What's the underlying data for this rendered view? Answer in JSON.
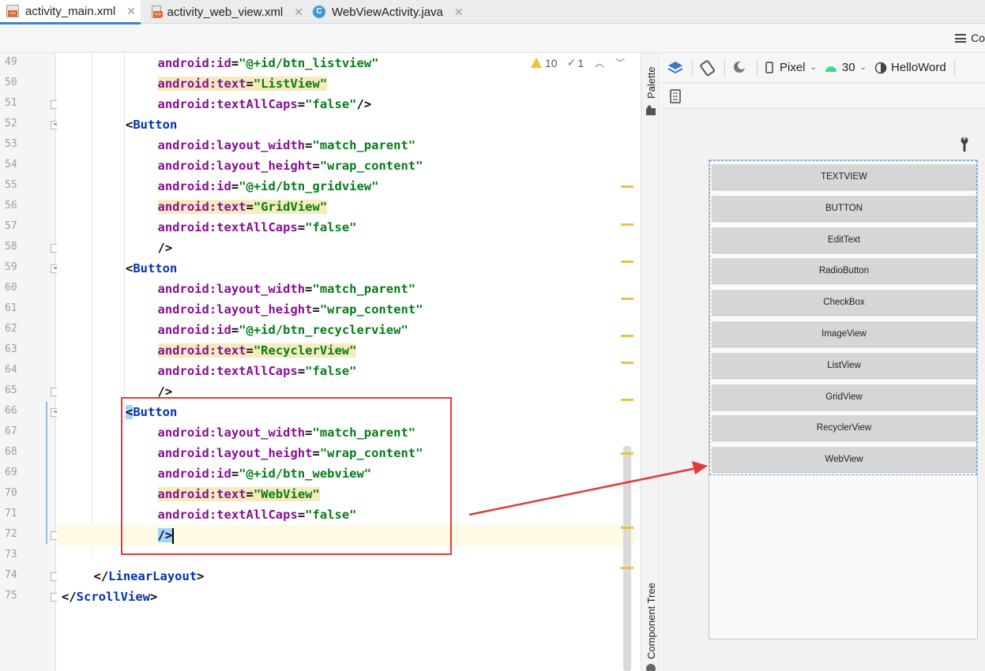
{
  "tabs": [
    {
      "label": "activity_main.xml",
      "type": "xml",
      "active": true
    },
    {
      "label": "activity_web_view.xml",
      "type": "xml",
      "active": false
    },
    {
      "label": "WebViewActivity.java",
      "type": "java",
      "active": false
    }
  ],
  "view_mode_label": "Co",
  "inspections": {
    "warnings": "10",
    "weak_warnings": "1"
  },
  "code_lines": [
    {
      "n": "49",
      "indent": 6,
      "parts": [
        [
          "attr",
          "android:id"
        ],
        [
          "pun",
          "="
        ],
        [
          "val",
          "\"@+id/btn_listview\""
        ]
      ]
    },
    {
      "n": "50",
      "indent": 6,
      "parts": [
        [
          "attrhl",
          "android:text"
        ],
        [
          "punhl",
          "="
        ],
        [
          "valhl",
          "\"ListView\""
        ]
      ]
    },
    {
      "n": "51",
      "indent": 6,
      "parts": [
        [
          "attr",
          "android:textAllCaps"
        ],
        [
          "pun",
          "="
        ],
        [
          "val",
          "\"false\""
        ],
        [
          "pun",
          "/>"
        ]
      ]
    },
    {
      "n": "52",
      "indent": 4,
      "parts": [
        [
          "pun",
          "<"
        ],
        [
          "tag",
          "Button"
        ]
      ]
    },
    {
      "n": "53",
      "indent": 6,
      "parts": [
        [
          "attr",
          "android:layout_width"
        ],
        [
          "pun",
          "="
        ],
        [
          "val",
          "\"match_parent\""
        ]
      ]
    },
    {
      "n": "54",
      "indent": 6,
      "parts": [
        [
          "attr",
          "android:layout_height"
        ],
        [
          "pun",
          "="
        ],
        [
          "val",
          "\"wrap_content\""
        ]
      ]
    },
    {
      "n": "55",
      "indent": 6,
      "parts": [
        [
          "attr",
          "android:id"
        ],
        [
          "pun",
          "="
        ],
        [
          "val",
          "\"@+id/btn_gridview\""
        ]
      ]
    },
    {
      "n": "56",
      "indent": 6,
      "parts": [
        [
          "attrhl",
          "android:text"
        ],
        [
          "punhl",
          "="
        ],
        [
          "valhl",
          "\"GridView\""
        ]
      ]
    },
    {
      "n": "57",
      "indent": 6,
      "parts": [
        [
          "attr",
          "android:textAllCaps"
        ],
        [
          "pun",
          "="
        ],
        [
          "val",
          "\"false\""
        ]
      ]
    },
    {
      "n": "58",
      "indent": 6,
      "parts": [
        [
          "pun",
          "/>"
        ]
      ]
    },
    {
      "n": "59",
      "indent": 4,
      "parts": [
        [
          "pun",
          "<"
        ],
        [
          "tag",
          "Button"
        ]
      ]
    },
    {
      "n": "60",
      "indent": 6,
      "parts": [
        [
          "attr",
          "android:layout_width"
        ],
        [
          "pun",
          "="
        ],
        [
          "val",
          "\"match_parent\""
        ]
      ]
    },
    {
      "n": "61",
      "indent": 6,
      "parts": [
        [
          "attr",
          "android:layout_height"
        ],
        [
          "pun",
          "="
        ],
        [
          "val",
          "\"wrap_content\""
        ]
      ]
    },
    {
      "n": "62",
      "indent": 6,
      "parts": [
        [
          "attr",
          "android:id"
        ],
        [
          "pun",
          "="
        ],
        [
          "val",
          "\"@+id/btn_recyclerview\""
        ]
      ]
    },
    {
      "n": "63",
      "indent": 6,
      "parts": [
        [
          "attrhl",
          "android:text"
        ],
        [
          "punhl",
          "="
        ],
        [
          "valhl",
          "\"RecyclerView\""
        ]
      ]
    },
    {
      "n": "64",
      "indent": 6,
      "parts": [
        [
          "attr",
          "android:textAllCaps"
        ],
        [
          "pun",
          "="
        ],
        [
          "val",
          "\"false\""
        ]
      ]
    },
    {
      "n": "65",
      "indent": 6,
      "parts": [
        [
          "pun",
          "/>"
        ]
      ]
    },
    {
      "n": "66",
      "indent": 4,
      "parts": [
        [
          "punsel",
          "<"
        ],
        [
          "tag",
          "Button"
        ]
      ]
    },
    {
      "n": "67",
      "indent": 6,
      "parts": [
        [
          "attr",
          "android:layout_width"
        ],
        [
          "pun",
          "="
        ],
        [
          "val",
          "\"match_parent\""
        ]
      ]
    },
    {
      "n": "68",
      "indent": 6,
      "parts": [
        [
          "attr",
          "android:layout_height"
        ],
        [
          "pun",
          "="
        ],
        [
          "val",
          "\"wrap_content\""
        ]
      ]
    },
    {
      "n": "69",
      "indent": 6,
      "parts": [
        [
          "attr",
          "android:id"
        ],
        [
          "pun",
          "="
        ],
        [
          "val",
          "\"@+id/btn_webview\""
        ]
      ]
    },
    {
      "n": "70",
      "indent": 6,
      "parts": [
        [
          "attrhl",
          "android:text"
        ],
        [
          "punhl",
          "="
        ],
        [
          "valhl",
          "\"WebView\""
        ]
      ]
    },
    {
      "n": "71",
      "indent": 6,
      "parts": [
        [
          "attr",
          "android:textAllCaps"
        ],
        [
          "pun",
          "="
        ],
        [
          "val",
          "\"false\""
        ]
      ]
    },
    {
      "n": "72",
      "indent": 6,
      "parts": [
        [
          "punsel",
          "/>"
        ],
        [
          "caret",
          ""
        ]
      ],
      "current": true
    },
    {
      "n": "73",
      "indent": 0,
      "parts": []
    },
    {
      "n": "74",
      "indent": 2,
      "parts": [
        [
          "pun",
          "</"
        ],
        [
          "tag",
          "LinearLayout"
        ],
        [
          "pun",
          ">"
        ]
      ]
    },
    {
      "n": "75",
      "indent": 0,
      "parts": [
        [
          "pun",
          "</"
        ],
        [
          "tag",
          "ScrollView"
        ],
        [
          "pun",
          ">"
        ]
      ]
    }
  ],
  "palette_label": "Palette",
  "component_tree_label": "Component Tree",
  "design_toolbar": {
    "device": "Pixel",
    "api": "30",
    "theme": "HelloWord"
  },
  "preview_buttons": [
    "TEXTVIEW",
    "BUTTON",
    "EditText",
    "RadioButton",
    "CheckBox",
    "ImageView",
    "ListView",
    "GridView",
    "RecyclerView",
    "WebView"
  ],
  "colors": {
    "annotation": "#e53935",
    "tab_underline": "#4083c9",
    "warning_mark": "#e7c63c"
  }
}
